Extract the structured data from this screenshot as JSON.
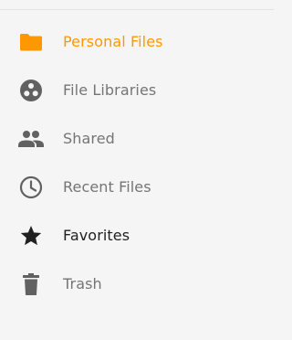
{
  "sidebar": {
    "items": [
      {
        "label": "Personal Files",
        "icon": "folder-icon",
        "active": true
      },
      {
        "label": "File Libraries",
        "icon": "libraries-icon",
        "active": false
      },
      {
        "label": "Shared",
        "icon": "people-icon",
        "active": false
      },
      {
        "label": "Recent Files",
        "icon": "clock-icon",
        "active": false
      },
      {
        "label": "Favorites",
        "icon": "star-icon",
        "active": false
      },
      {
        "label": "Trash",
        "icon": "trash-icon",
        "active": false
      }
    ]
  },
  "colors": {
    "accent": "#ff9800",
    "text": "#757575",
    "text_dark": "#212121",
    "icon": "#616161",
    "background": "#f5f5f5"
  }
}
